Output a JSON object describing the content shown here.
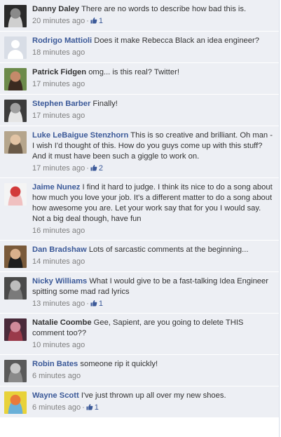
{
  "comments": [
    {
      "author": "Danny Daley",
      "text": "There are no words to describe how bad this is.",
      "time": "20 minutes ago",
      "likes": "1",
      "avatar_colors": [
        "#2a2a2a",
        "#8a8a8a",
        "#cfcfcf"
      ]
    },
    {
      "author": "Rodrigo Mattioli",
      "text": "Does it make Rebecca Black an idea engineer?",
      "time": "18 minutes ago",
      "likes": null,
      "avatar_colors": [
        "#d8dde6",
        "#ffffff",
        "#ffffff"
      ]
    },
    {
      "author": "Patrick Fidgen",
      "text": "omg... is this real? Twitter!",
      "time": "17 minutes ago",
      "likes": null,
      "avatar_colors": [
        "#6c8a4a",
        "#c48a6a",
        "#3b2a20"
      ]
    },
    {
      "author": "Stephen Barber",
      "text": "Finally!",
      "time": "17 minutes ago",
      "likes": null,
      "avatar_colors": [
        "#3c3c3c",
        "#a0a0a0",
        "#e5e5e5"
      ]
    },
    {
      "author": "Luke LeBaigue Stenzhorn",
      "text": "This is so creative and brilliant. Oh man - I wish I'd thought of this. How do you guys come up with this stuff? And it must have been such a giggle to work on.",
      "time": "17 minutes ago",
      "likes": "2",
      "avatar_colors": [
        "#b5a58c",
        "#e2c4a5",
        "#6a5a48"
      ]
    },
    {
      "author": "Jaime Nunez",
      "text": "I find it hard to judge. I think its nice to do a song about how much you love your job. It's a different matter to do a song about how awesome you are. Let your work say that for you I would say. Not a big deal though, have fun",
      "time": "16 minutes ago",
      "likes": null,
      "avatar_colors": [
        "#f4f4f4",
        "#d23a3a",
        "#f0c0c0"
      ]
    },
    {
      "author": "Dan Bradshaw",
      "text": "Lots of sarcastic comments at the beginning...",
      "time": "14 minutes ago",
      "likes": null,
      "avatar_colors": [
        "#7a5a3a",
        "#d9b08c",
        "#1e1e1e"
      ]
    },
    {
      "author": "Nicky Williams",
      "text": "What I would give to be a fast-talking Idea Engineer spitting some mad rad lyrics",
      "time": "13 minutes ago",
      "likes": "1",
      "avatar_colors": [
        "#4a4a4a",
        "#bdbdbd",
        "#7a7a7a"
      ]
    },
    {
      "author": "Natalie Coombe",
      "text": "Gee, Sapient, are you going to delete THIS comment too??",
      "time": "10 minutes ago",
      "likes": null,
      "avatar_colors": [
        "#4a2a3a",
        "#d08a9a",
        "#9a3a4a"
      ]
    },
    {
      "author": "Robin Bates",
      "text": "someone rip it quickly!",
      "time": "6 minutes ago",
      "likes": null,
      "avatar_colors": [
        "#5a5a5a",
        "#c8c8c8",
        "#8a8a8a"
      ]
    },
    {
      "author": "Wayne Scott",
      "text": "I've just thrown up all over my new shoes.",
      "time": "6 minutes ago",
      "likes": "1",
      "avatar_colors": [
        "#e8d23a",
        "#e87a3a",
        "#6ab0d8"
      ]
    }
  ],
  "ui": {
    "link_color": "#3b5998",
    "row_background": "#edeff4",
    "meta_color": "#808080",
    "like_icon": "thumbs-up-icon",
    "meta_separator": "·"
  }
}
